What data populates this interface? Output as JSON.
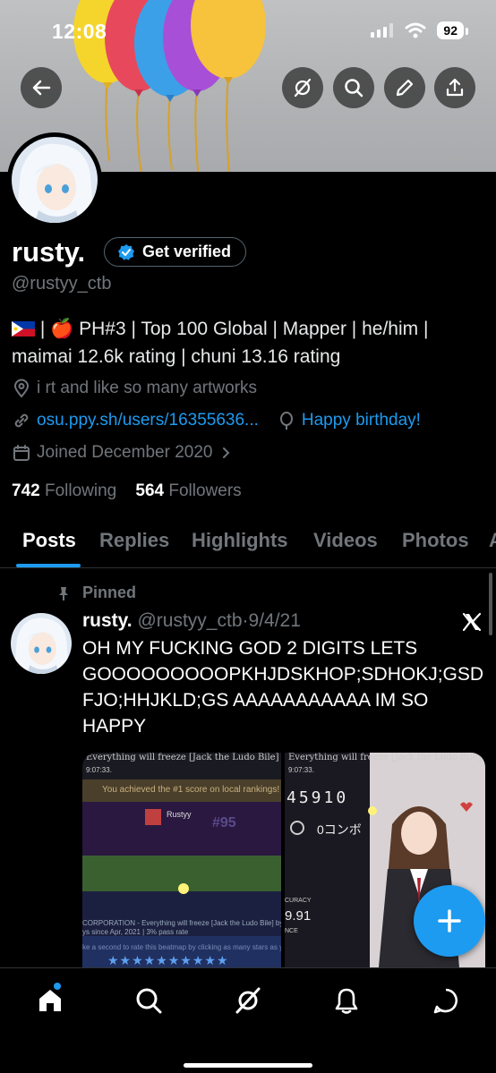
{
  "status_bar": {
    "time": "12:08",
    "battery": "92"
  },
  "profile": {
    "name": "rusty.",
    "verify_label": "Get verified",
    "handle": "@rustyy_ctb",
    "bio_line1": " | 🍎 PH#3 | Top 100 Global | Mapper | he/him |",
    "bio_line2": "maimai 12.6k rating | chuni 13.16 rating",
    "location": "i rt and like so many artworks",
    "website": "osu.ppy.sh/users/16355636...",
    "birthday": "Happy birthday!",
    "joined": "Joined December 2020",
    "following_count": "742",
    "following_label": "Following",
    "followers_count": "564",
    "followers_label": "Followers"
  },
  "tabs": [
    {
      "label": "Posts",
      "active": true
    },
    {
      "label": "Replies"
    },
    {
      "label": "Highlights"
    },
    {
      "label": "Videos"
    },
    {
      "label": "Photos"
    },
    {
      "label": "A"
    }
  ],
  "post": {
    "pinned_label": "Pinned",
    "author": "rusty.",
    "handle": "@rustyy_ctb",
    "separator": "·",
    "date": "9/4/21",
    "text": "OH MY FUCKING GOD 2 DIGITS LETS GOOOOOOOOOPKHJDSKHOP;SDHOKJ;GSDFJO;HHJKLD;GS AAAAAAAAAAA IM SO HAPPY",
    "media1": {
      "title": "Everything will freeze [Jack the Ludo Bile]",
      "time": "9:07:33.",
      "banner": "You achieved the #1 score on local rankings!",
      "player": "Rustyy",
      "rank": "#95",
      "footer": "CORPORATION - Everything will freeze [Jack the Ludo Bile] by NyaletiOwO",
      "footer2": "ys since Apr, 2021 | 3% pass rate",
      "footer3": "ke a second to rate this beatmap by clicking as many stars as you wa"
    },
    "media2": {
      "title": "Everything will freeze [Jack the Ludo Bile]",
      "time": "9:07:33.",
      "score": "45910",
      "combo": "0コンボ",
      "accuracy_label": "CURACY",
      "accuracy": "9.91",
      "nce": "NCE"
    }
  },
  "colors": {
    "accent": "#1d9bf0",
    "muted": "#71767b",
    "border": "#2f3336"
  },
  "icons": {
    "back": "arrow-left-icon",
    "grok": "grok-icon",
    "search": "search-icon",
    "edit": "pencil-icon",
    "share": "share-icon",
    "nav": [
      "home-icon",
      "search-icon",
      "grok-icon",
      "bell-icon",
      "message-icon"
    ]
  }
}
